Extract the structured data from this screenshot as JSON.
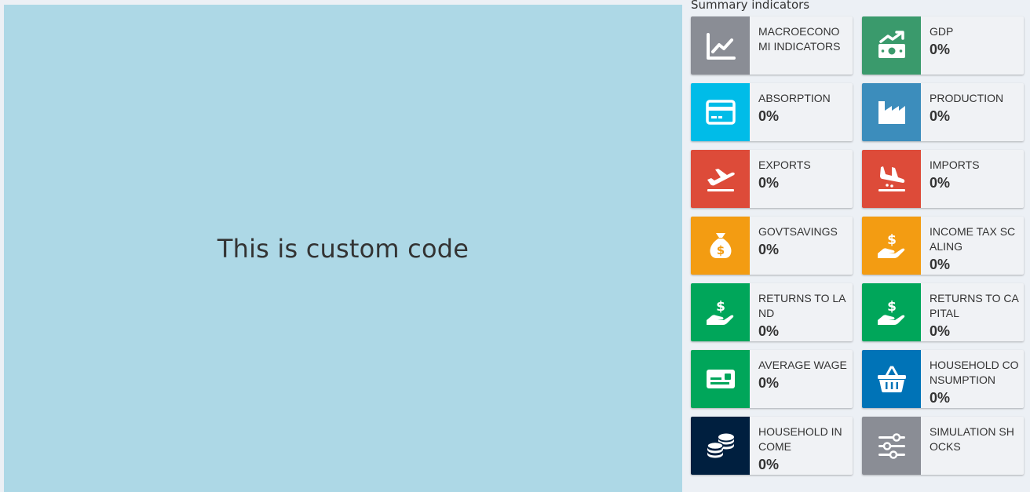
{
  "custom_panel": {
    "text": "This is custom code",
    "background": "#add8e6"
  },
  "summary": {
    "title": "Summary indicators",
    "boxes": [
      {
        "label": "MACROECONOMI INDICATORS",
        "value": "",
        "color": "#8a8d95",
        "icon": "chart-line-icon"
      },
      {
        "label": "GDP",
        "value": "0%",
        "color": "#3a9a6c",
        "icon": "money-growth-icon"
      },
      {
        "label": "ABSORPTION",
        "value": "0%",
        "color": "#00bce8",
        "icon": "credit-card-icon"
      },
      {
        "label": "PRODUCTION",
        "value": "0%",
        "color": "#3c8dbc",
        "icon": "industry-icon"
      },
      {
        "label": "EXPORTS",
        "value": "0%",
        "color": "#dd4b39",
        "icon": "plane-departure-icon"
      },
      {
        "label": "IMPORTS",
        "value": "0%",
        "color": "#dd4b39",
        "icon": "plane-arrival-icon"
      },
      {
        "label": "GOVTSAVINGS",
        "value": "0%",
        "color": "#f39c12",
        "icon": "money-bag-icon"
      },
      {
        "label": "INCOME TAX SCALING",
        "value": "0%",
        "color": "#f39c12",
        "icon": "hand-dollar-icon"
      },
      {
        "label": "RETURNS TO LAND",
        "value": "0%",
        "color": "#00a65a",
        "icon": "hand-dollar-icon"
      },
      {
        "label": "RETURNS TO CAPITAL",
        "value": "0%",
        "color": "#00a65a",
        "icon": "hand-dollar-icon"
      },
      {
        "label": "AVERAGE WAGE",
        "value": "0%",
        "color": "#00a65a",
        "icon": "money-check-icon"
      },
      {
        "label": "HOUSEHOLD CONSUMPTION",
        "value": "0%",
        "color": "#0073b7",
        "icon": "shopping-basket-icon"
      },
      {
        "label": "HOUSEHOLD INCOME",
        "value": "0%",
        "color": "#001f3f",
        "icon": "coins-icon"
      },
      {
        "label": "SIMULATION SHOCKS",
        "value": "",
        "color": "#8a8d95",
        "icon": "sliders-icon"
      }
    ]
  }
}
